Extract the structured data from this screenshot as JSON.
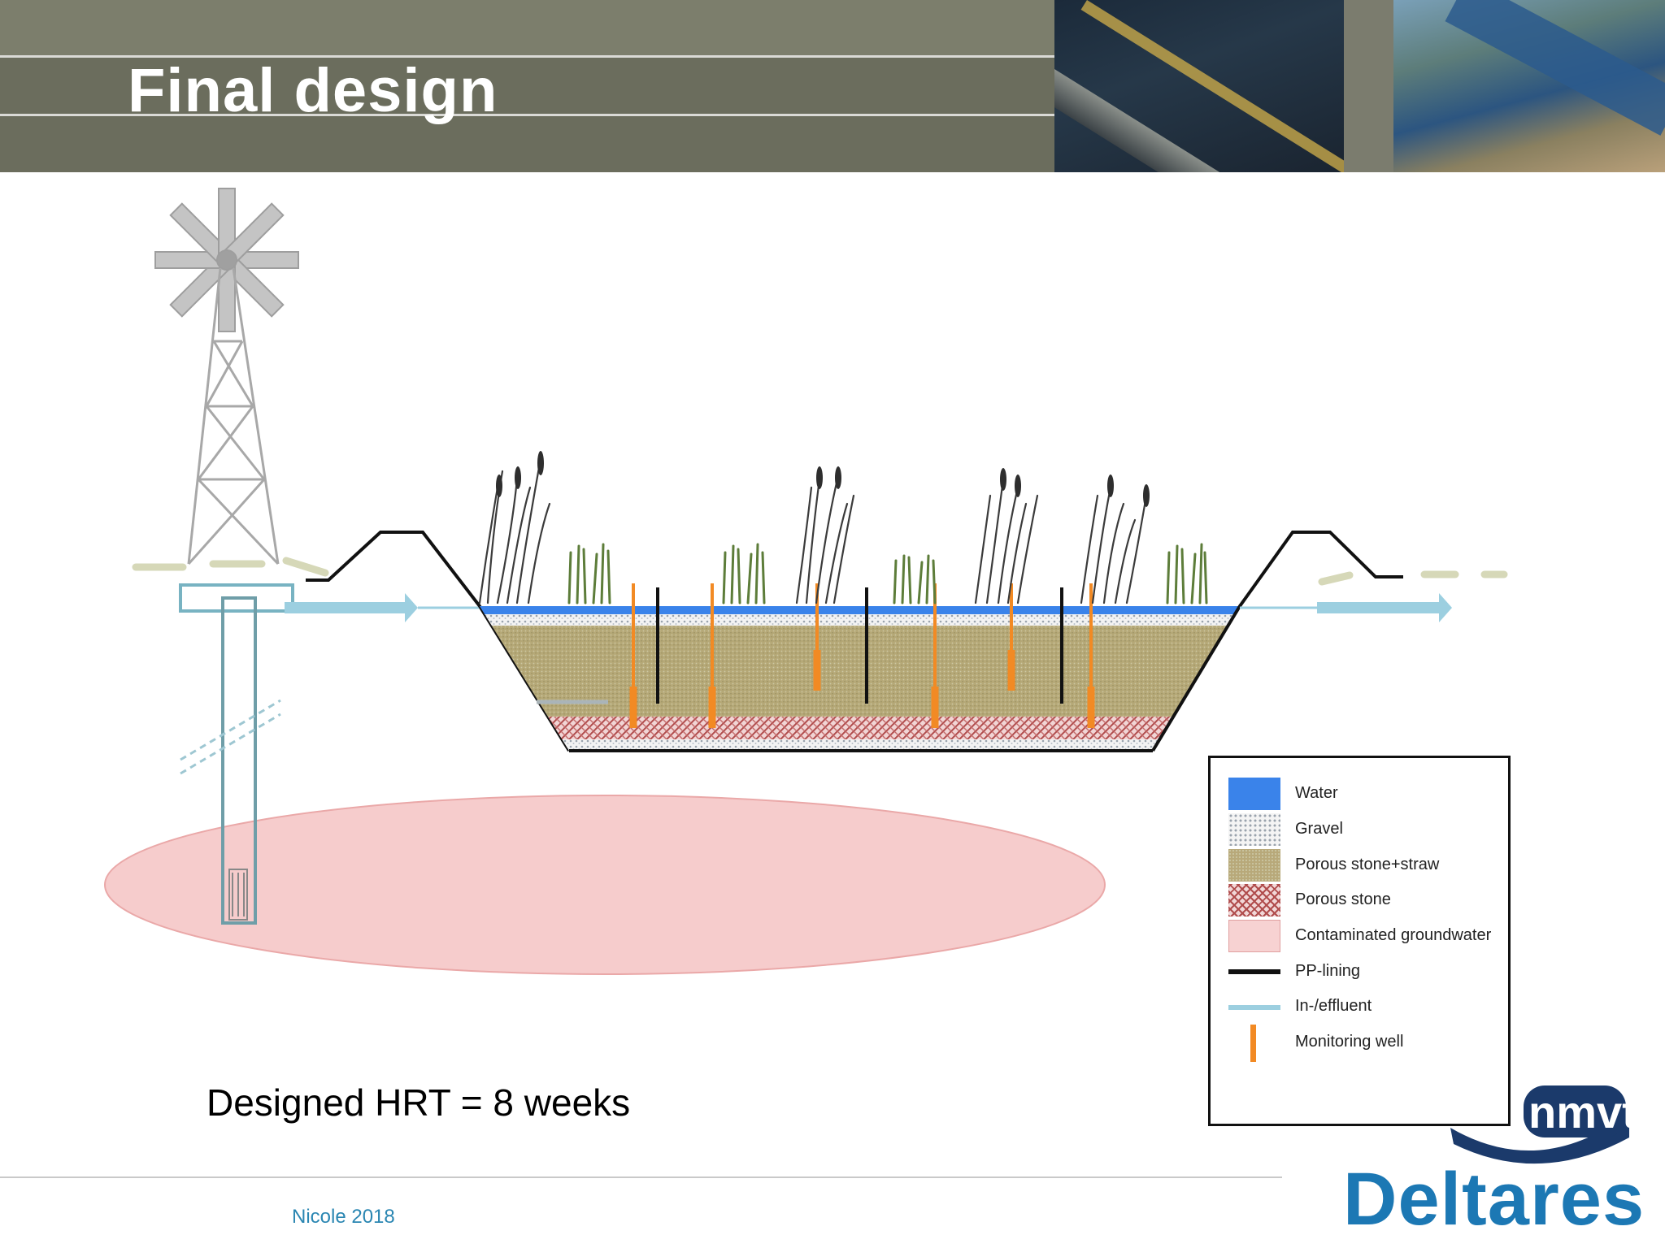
{
  "header": {
    "title": "Final design"
  },
  "legend": {
    "items": [
      {
        "label": "Water",
        "swatch": "water",
        "color": "#3a83ea"
      },
      {
        "label": "Gravel",
        "swatch": "gravel",
        "color": "#dcdfe3"
      },
      {
        "label": "Porous stone+straw",
        "swatch": "porous-straw",
        "color": "#b8a97a"
      },
      {
        "label": "Porous stone",
        "swatch": "porous-stone",
        "color": "#b04c4c"
      },
      {
        "label": "Contaminated groundwater",
        "swatch": "groundwater",
        "color": "#f7d2d2"
      },
      {
        "label": "PP-lining",
        "swatch": "line",
        "color": "#111111"
      },
      {
        "label": "In-/effluent",
        "swatch": "line",
        "color": "#9ccfe0"
      },
      {
        "label": "Monitoring well",
        "swatch": "well",
        "color": "#f28a24"
      }
    ]
  },
  "body": {
    "hrt_text": "Designed HRT = 8 weeks"
  },
  "footer": {
    "text": "Nicole 2018"
  },
  "logos": {
    "primary": "Deltares",
    "secondary": "nmvt"
  },
  "icons": {
    "windmill": "windmill-icon",
    "reed": "reed-plant-icon"
  },
  "colors": {
    "header_bg": "#6b6d5d",
    "title_color": "#ffffff",
    "footer_text": "#2a86b2",
    "logo_blue": "#1c78b4",
    "logo_navy": "#1b3a6b",
    "effluent_arrow": "#9ccfe0",
    "well_orange": "#f28a24"
  }
}
